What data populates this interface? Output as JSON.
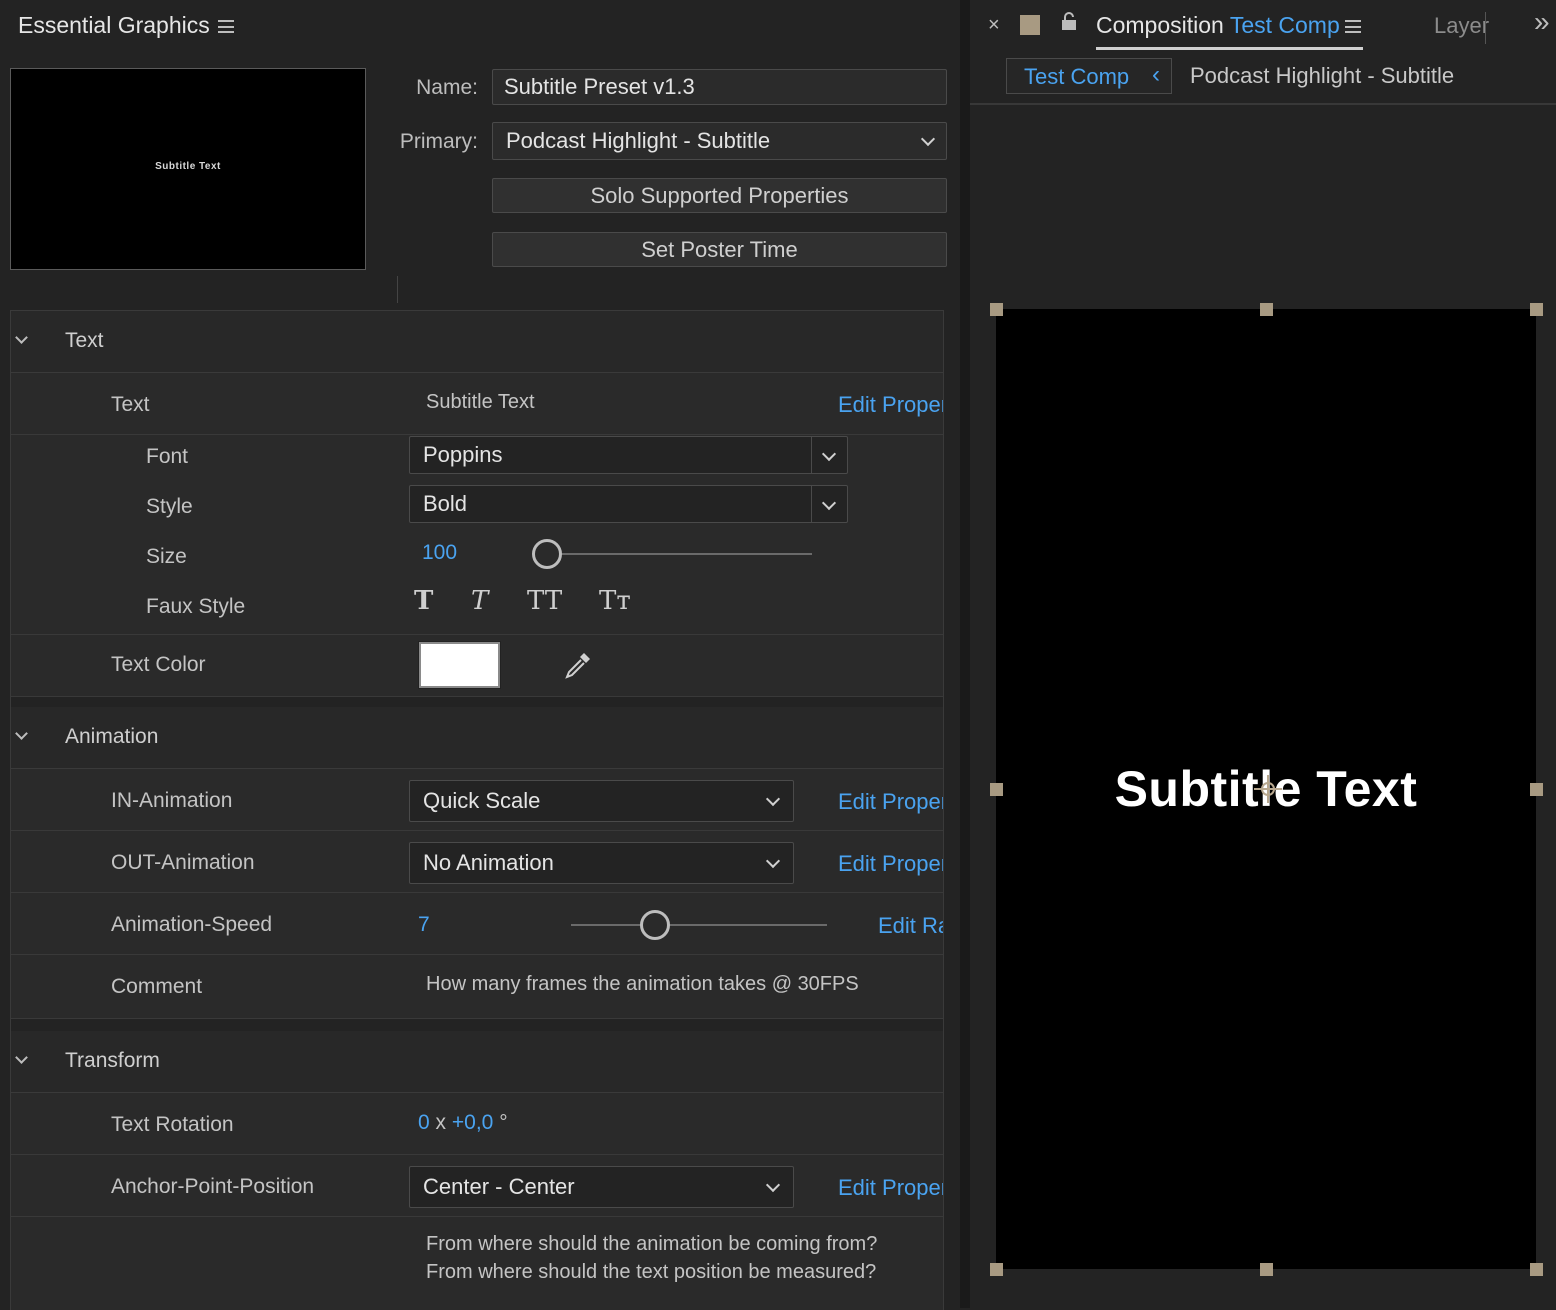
{
  "left_panel": {
    "title": "Essential Graphics",
    "thumbnail_text": "Subtitle Text",
    "name_label": "Name:",
    "name_value": "Subtitle Preset v1.3",
    "primary_label": "Primary:",
    "primary_value": "Podcast Highlight - Subtitle",
    "solo_button": "Solo Supported Properties",
    "poster_button": "Set Poster Time"
  },
  "sections": {
    "text": {
      "title": "Text",
      "text_label": "Text",
      "text_value": "Subtitle Text",
      "text_link": "Edit Proper",
      "font_label": "Font",
      "font_value": "Poppins",
      "style_label": "Style",
      "style_value": "Bold",
      "size_label": "Size",
      "size_value": "100",
      "size_level": 0.0,
      "faux_label": "Faux Style",
      "faux_bold": "T",
      "faux_italic": "T",
      "faux_allcaps": "TT",
      "faux_smallcaps": "Tт",
      "color_label": "Text Color",
      "color_value": "#ffffff"
    },
    "animation": {
      "title": "Animation",
      "in_label": "IN-Animation",
      "in_value": "Quick Scale",
      "in_link": "Edit Proper",
      "out_label": "OUT-Animation",
      "out_value": "No Animation",
      "out_link": "Edit Proper",
      "speed_label": "Animation-Speed",
      "speed_value": "7",
      "speed_link": "Edit Ra",
      "comment_label": "Comment",
      "comment_value": "How many frames the animation takes @ 30FPS"
    },
    "transform": {
      "title": "Transform",
      "rotation_label": "Text Rotation",
      "rotation_turns": "0",
      "rotation_x": "x",
      "rotation_deg": "+0,0",
      "rotation_unit": "°",
      "anchor_label": "Anchor-Point-Position",
      "anchor_value": "Center - Center",
      "anchor_link": "Edit Proper",
      "note_line1": "From where should the animation be coming from?",
      "note_line2": "From where should the text position be measured?"
    }
  },
  "right_panel": {
    "close": "×",
    "tab_prefix": "Composition",
    "tab_comp": "Test Comp",
    "layer_tab": "Layer",
    "more": "»",
    "breadcrumb_active": "Test Comp",
    "breadcrumb_sep": "‹",
    "breadcrumb_item": "Podcast Highlight - Subtitle",
    "comp_text": "Subtitle Text"
  },
  "colors": {
    "accent": "#4aa3f0",
    "label_swatch": "#a89a82"
  }
}
